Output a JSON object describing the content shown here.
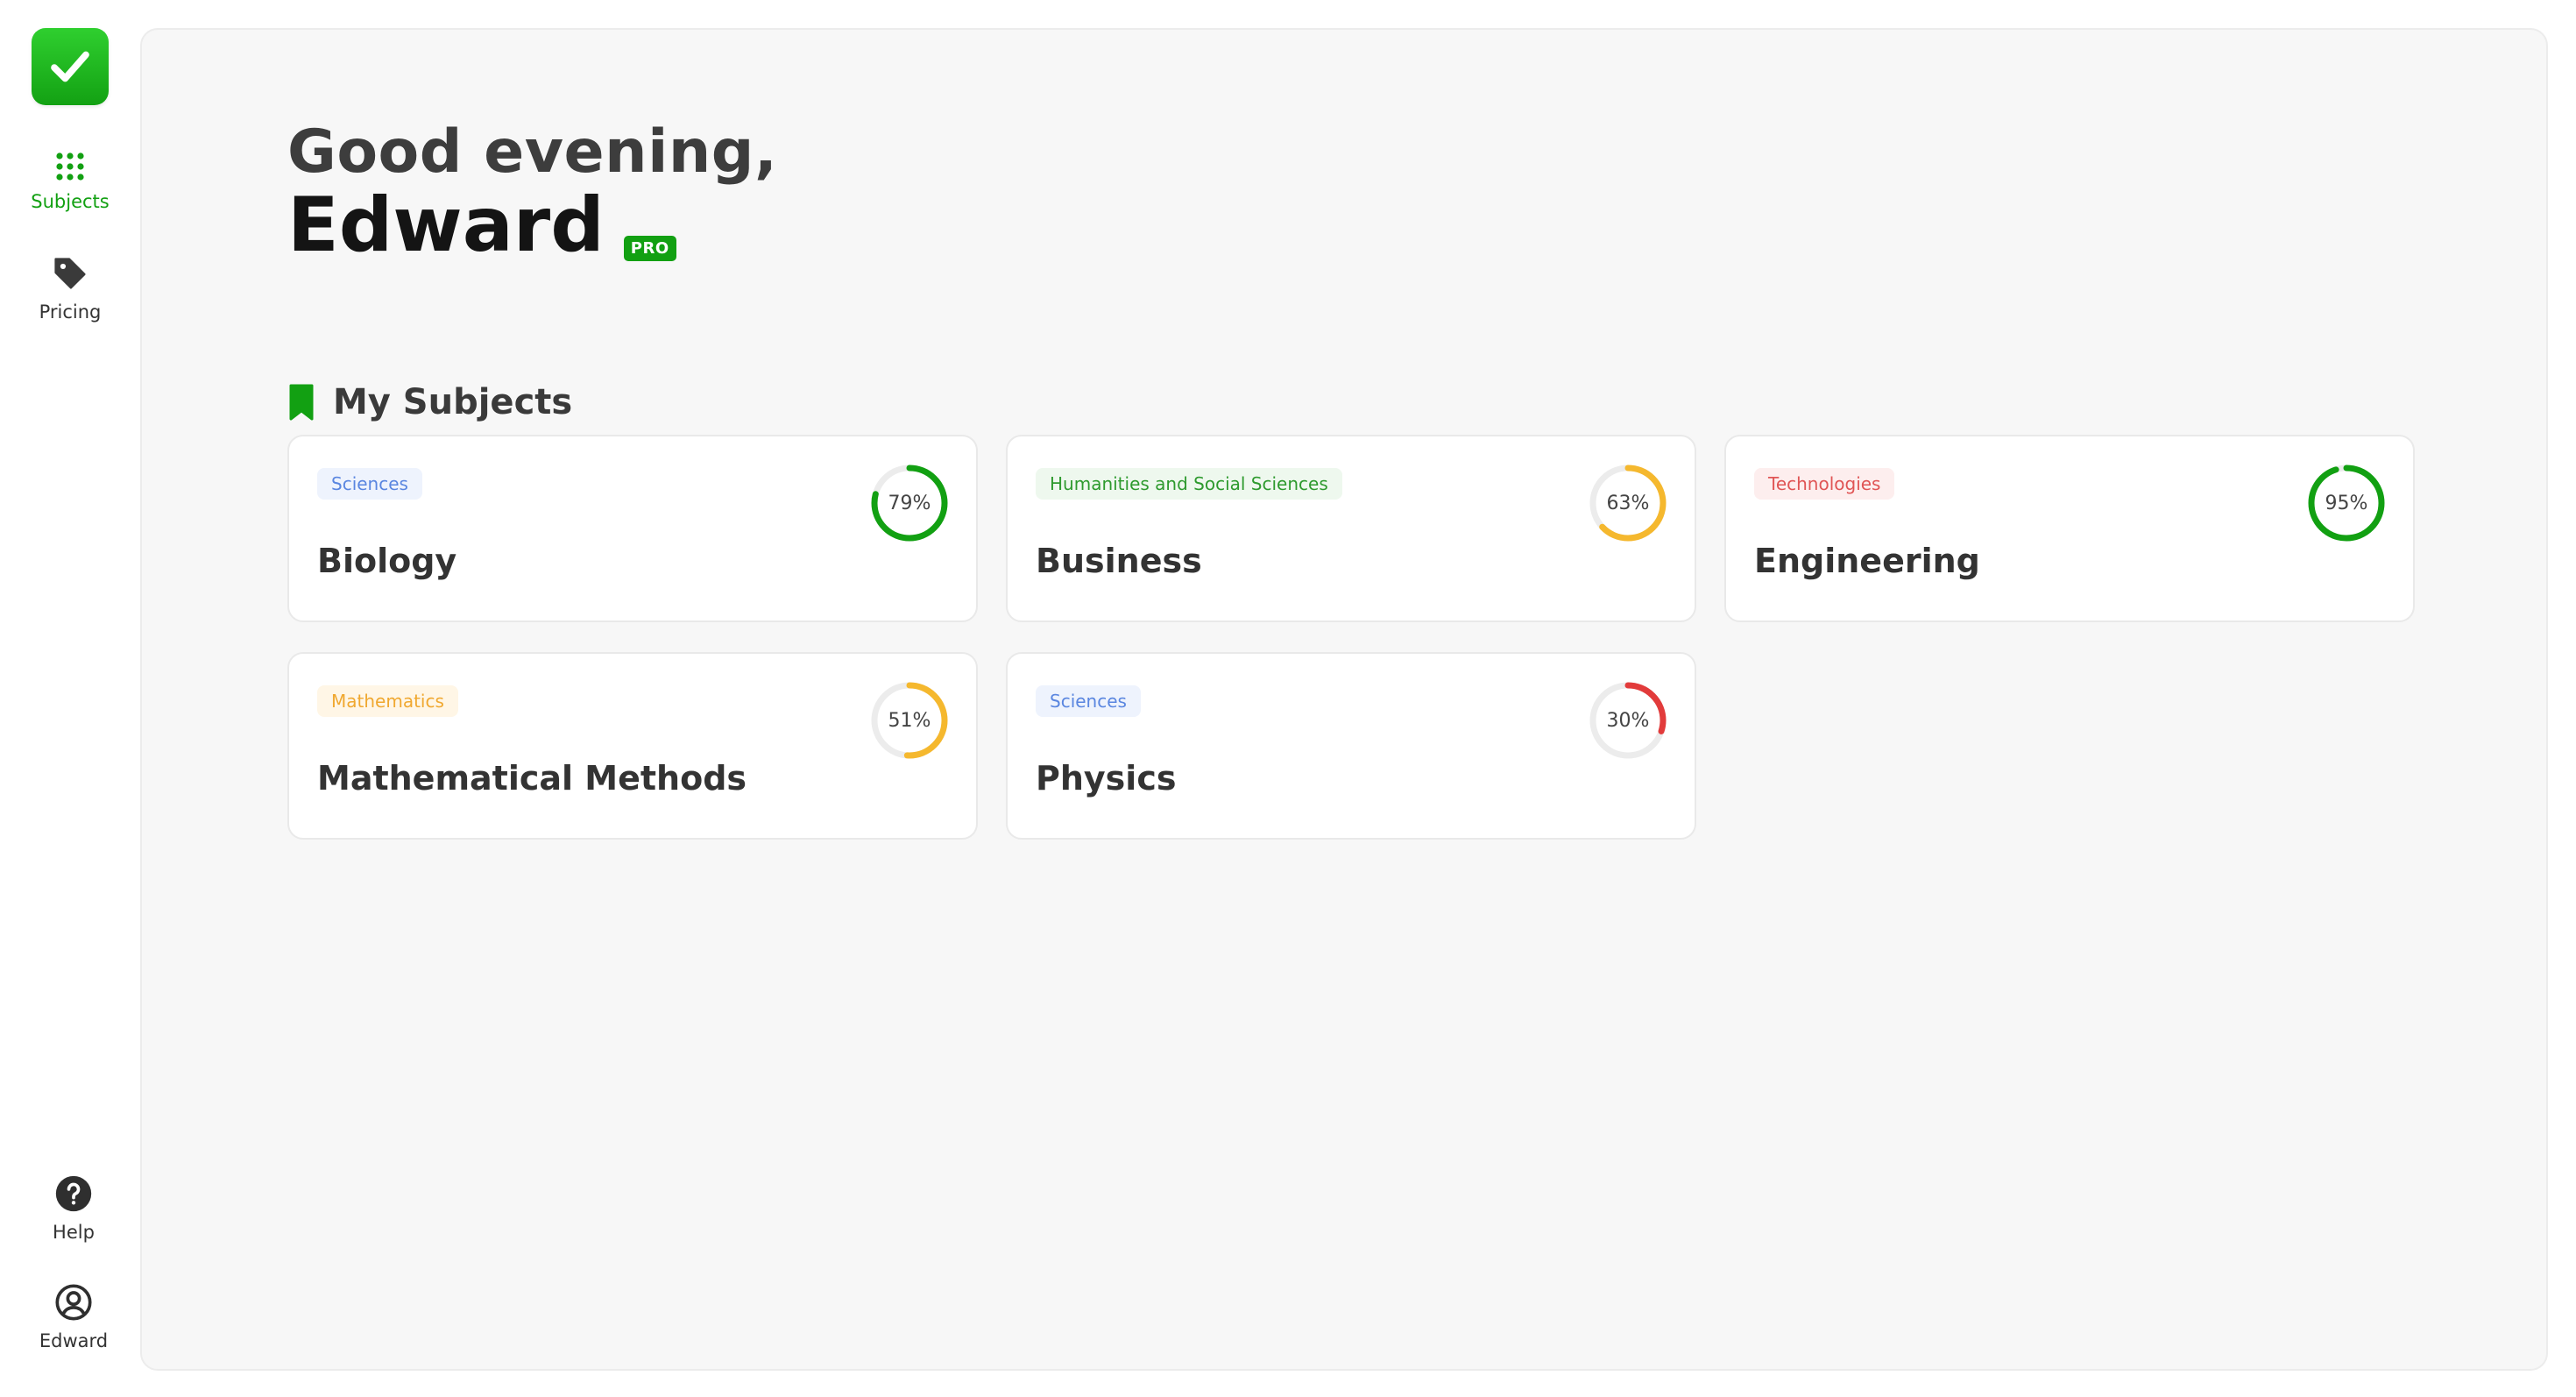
{
  "sidebar": {
    "nav": [
      {
        "label": "Subjects",
        "icon": "grid-dots-icon",
        "active": true
      },
      {
        "label": "Pricing",
        "icon": "tag-icon",
        "active": false
      }
    ],
    "bottom": [
      {
        "label": "Help",
        "icon": "question-circle-icon"
      },
      {
        "label": "Edward",
        "icon": "user-circle-icon"
      }
    ]
  },
  "header": {
    "greeting": "Good evening,",
    "name": "Edward",
    "badge": "PRO"
  },
  "section": {
    "title": "My Subjects",
    "icon": "bookmark-icon"
  },
  "colors": {
    "accent": "#12a012",
    "good": "#12a012",
    "medium": "#f5b82e",
    "low": "#e23b3b"
  },
  "subjects": [
    {
      "category": "Sciences",
      "name": "Biology",
      "progress": 79,
      "progress_label": "79%",
      "category_color": "#5a86e0",
      "category_bg": "#eef3fd",
      "ring_color": "#12a012"
    },
    {
      "category": "Humanities and Social Sciences",
      "name": "Business",
      "progress": 63,
      "progress_label": "63%",
      "category_color": "#2e9a2e",
      "category_bg": "#eef8ee",
      "ring_color": "#f5b82e"
    },
    {
      "category": "Technologies",
      "name": "Engineering",
      "progress": 95,
      "progress_label": "95%",
      "category_color": "#e05555",
      "category_bg": "#fdeeee",
      "ring_color": "#12a012"
    },
    {
      "category": "Mathematics",
      "name": "Mathematical Methods",
      "progress": 51,
      "progress_label": "51%",
      "category_color": "#f0a830",
      "category_bg": "#fff6e6",
      "ring_color": "#f5b82e"
    },
    {
      "category": "Sciences",
      "name": "Physics",
      "progress": 30,
      "progress_label": "30%",
      "category_color": "#5a86e0",
      "category_bg": "#eef3fd",
      "ring_color": "#e23b3b"
    }
  ]
}
